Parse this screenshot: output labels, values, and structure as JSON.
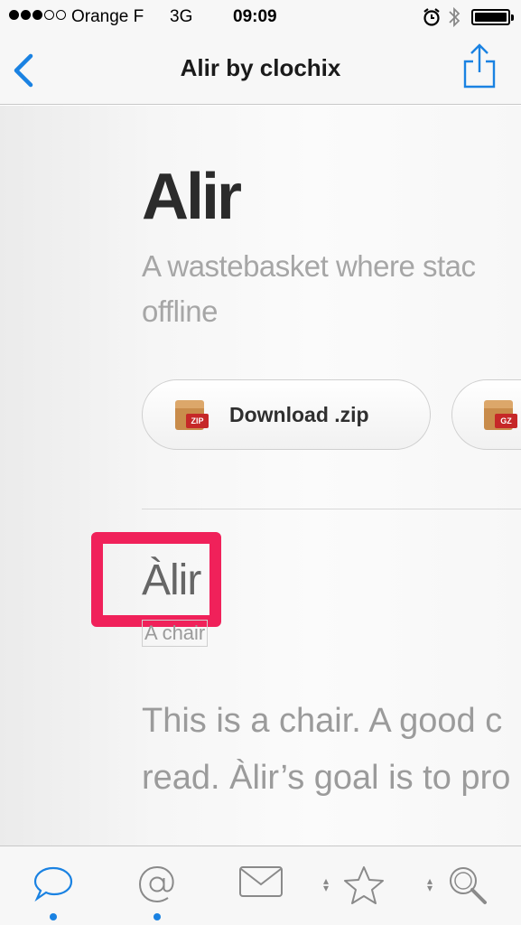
{
  "status_bar": {
    "signal_dots_filled": 3,
    "signal_dots_total": 5,
    "carrier": "Orange F",
    "network": "3G",
    "time": "09:09",
    "alarm_icon": "alarm-clock-icon",
    "bluetooth_icon": "bluetooth-icon",
    "battery_level": 1.0
  },
  "nav": {
    "title": "Alir by clochix",
    "back_icon": "chevron-left-icon",
    "share_icon": "share-icon"
  },
  "repo": {
    "title": "Alir",
    "description": "A wastebasket where stac\noffline"
  },
  "downloads": [
    {
      "label": "Download .zip",
      "badge": "ZIP",
      "icon": "zip-archive-icon"
    },
    {
      "label": "",
      "badge": "GZ",
      "icon": "gz-archive-icon"
    }
  ],
  "readme": {
    "heading": "Àlir",
    "image_caption": "A chair",
    "body": "This is a chair. A good c\nread. Àlir’s goal is to pro"
  },
  "tab_bar": {
    "items": [
      {
        "icon": "chat-bubble-icon",
        "has_indicator": true,
        "active": true
      },
      {
        "icon": "at-sign-icon",
        "has_indicator": true,
        "active": false
      },
      {
        "icon": "envelope-icon",
        "has_indicator": false,
        "active": false
      },
      {
        "icon": "star-icon",
        "has_indicator": false,
        "active": false,
        "sortable": true
      },
      {
        "icon": "search-icon",
        "has_indicator": false,
        "active": false,
        "sortable": true
      }
    ]
  },
  "colors": {
    "accent": "#1a82e2",
    "highlight": "#f0215a"
  }
}
